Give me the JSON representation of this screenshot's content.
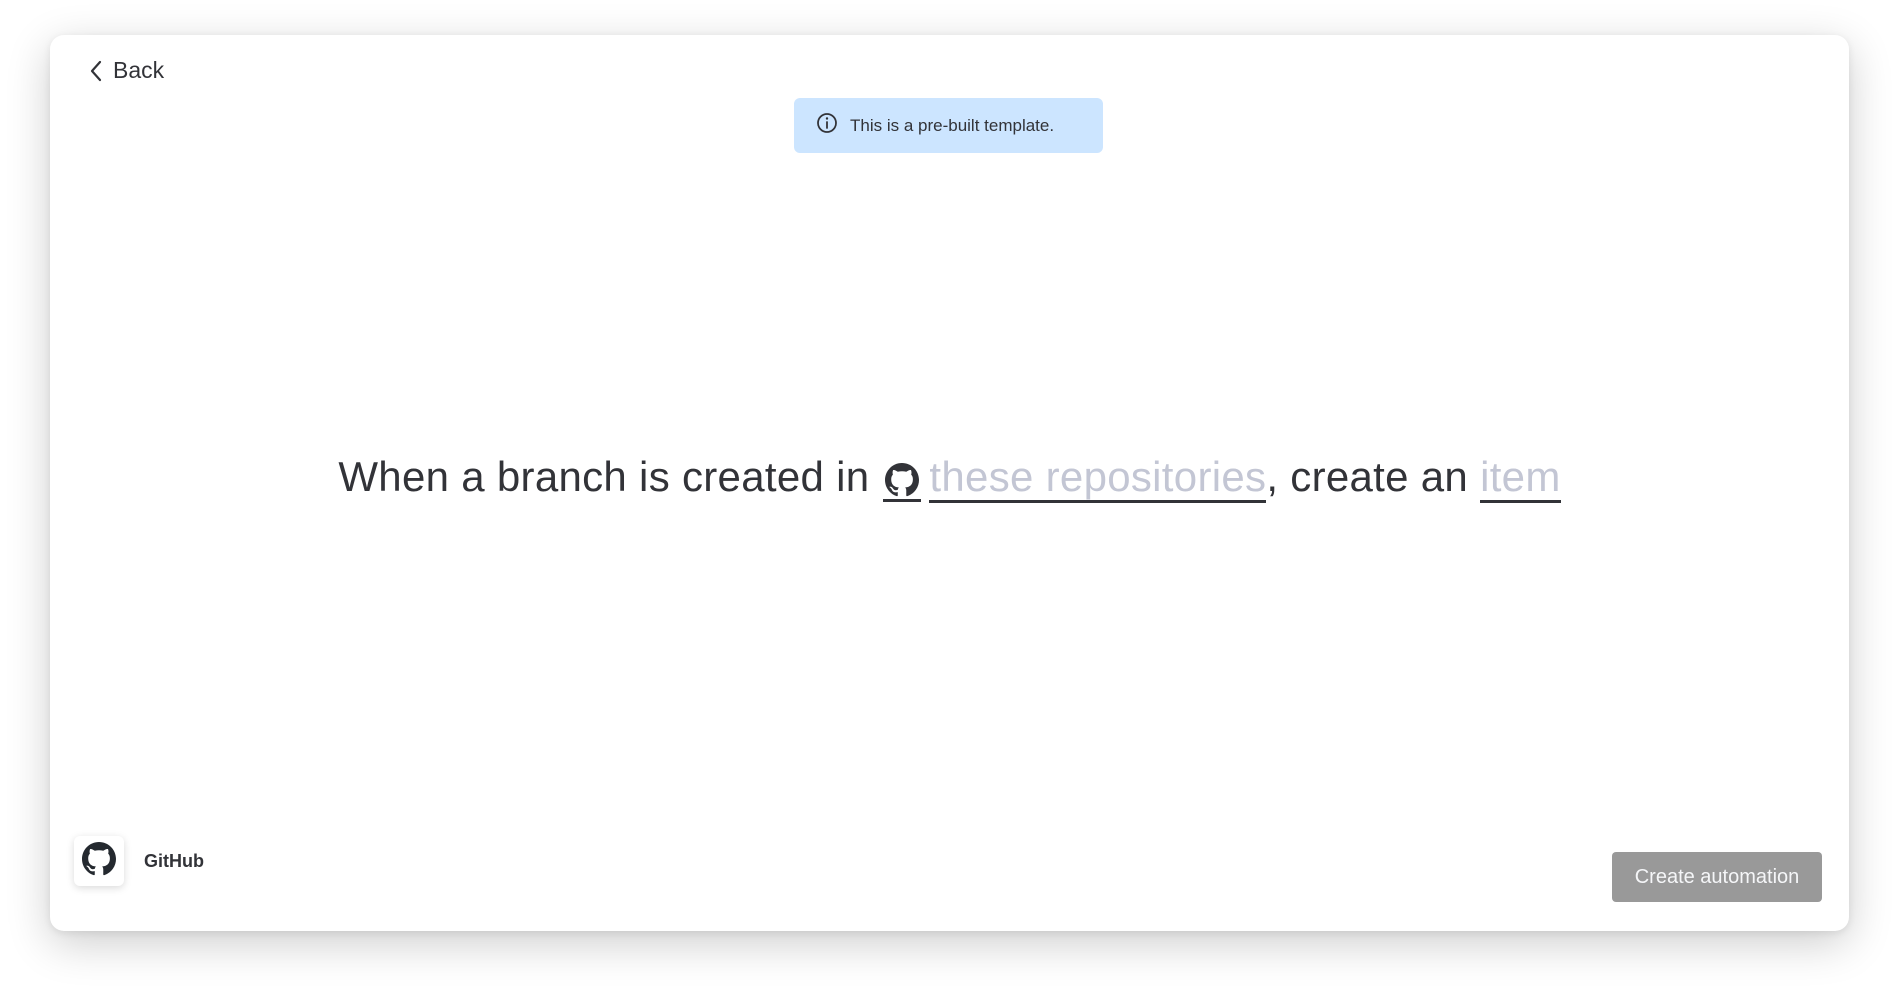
{
  "header": {
    "back_label": "Back"
  },
  "banner": {
    "text": "This is a pre-built template.",
    "background": "#cce5ff"
  },
  "recipe": {
    "part1": "When a branch is created in",
    "repositories_field": "these repositories",
    "part2": ", create an",
    "item_field": "item"
  },
  "footer": {
    "app_name": "GitHub",
    "create_label": "Create automation"
  },
  "icons": {
    "back": "chevron-left-icon",
    "info": "info-icon",
    "github": "github-icon"
  },
  "colors": {
    "text": "#323338",
    "placeholder": "#c3c6d4",
    "button_disabled": "#999999"
  }
}
